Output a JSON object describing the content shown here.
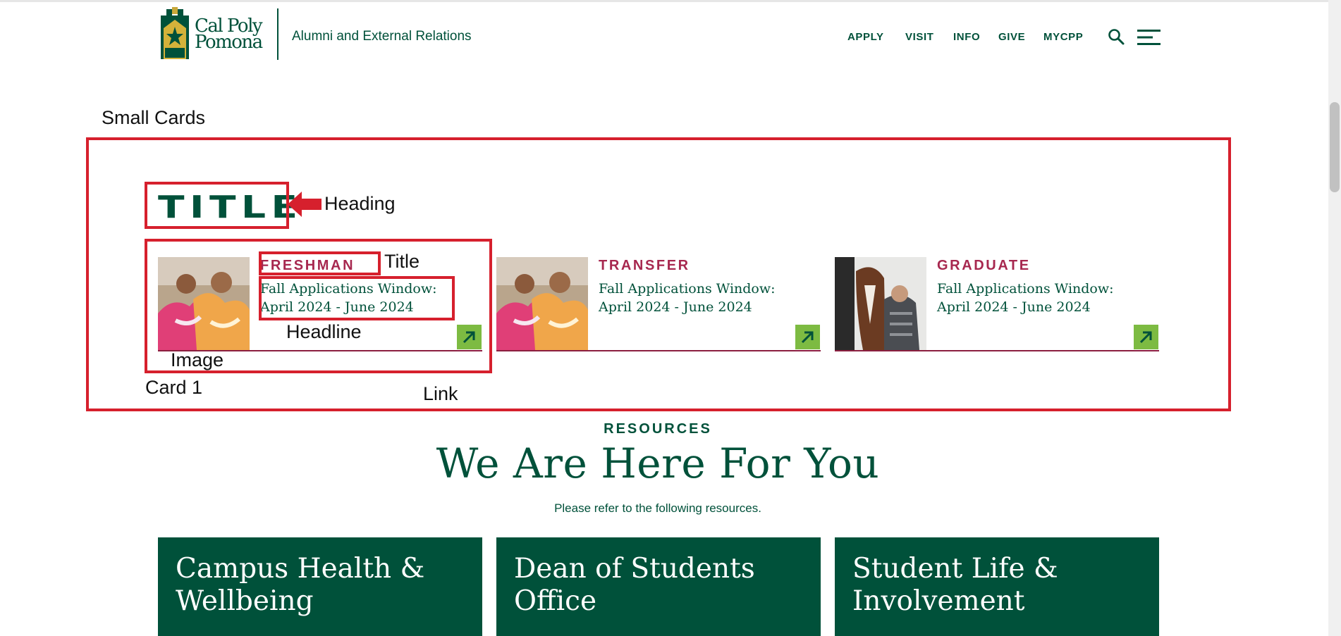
{
  "header": {
    "logo_text_line1": "Cal Poly",
    "logo_text_line2": "Pomona",
    "site_name": "Alumni and External Relations",
    "nav": [
      "APPLY",
      "VISIT",
      "INFO",
      "GIVE",
      "MYCPP"
    ]
  },
  "annotations": {
    "small_cards": "Small Cards",
    "heading": "Heading",
    "title": "Title",
    "headline": "Headline",
    "image": "Image",
    "card1": "Card 1",
    "link": "Link"
  },
  "section": {
    "heading": "TITLE"
  },
  "cards": [
    {
      "title": "FRESHMAN",
      "headline": "Fall Applications Window: April 2024 - June 2024"
    },
    {
      "title": "TRANSFER",
      "headline": "Fall Applications Window: April 2024 - June 2024"
    },
    {
      "title": "GRADUATE",
      "headline": "Fall Applications Window: April 2024 - June 2024"
    }
  ],
  "resources": {
    "label": "RESOURCES",
    "heading": "We Are Here For You",
    "description": "Please refer to the following resources.",
    "boxes": [
      {
        "title": "Campus Health & Wellbeing"
      },
      {
        "title": "Dean of Students Office"
      },
      {
        "title": "Student Life & Involvement"
      }
    ]
  },
  "colors": {
    "brand_green": "#00513a",
    "title_maroon": "#a7284f",
    "link_green": "#7dbb42",
    "annotation_red": "#d6202d"
  }
}
